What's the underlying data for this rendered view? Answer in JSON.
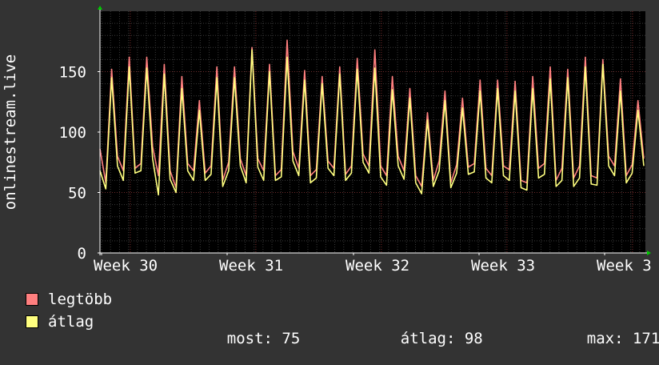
{
  "chart_data": {
    "type": "line",
    "ylabel": "onlinestream.live",
    "ylim": [
      0,
      200
    ],
    "yticks": [
      0,
      50,
      100,
      150
    ],
    "xticks": [
      "Week 30",
      "Week 31",
      "Week 32",
      "Week 33",
      "Week 3"
    ],
    "grid": true,
    "legend_placement": "bottom-left",
    "series": [
      {
        "name": "legtöbb",
        "color": "#ff7f7f",
        "values": [
          86,
          58,
          152,
          80,
          68,
          162,
          70,
          74,
          162,
          88,
          64,
          156,
          68,
          54,
          146,
          74,
          68,
          126,
          66,
          72,
          154,
          60,
          75,
          154,
          78,
          64,
          170,
          78,
          68,
          156,
          64,
          69,
          176,
          84,
          70,
          151,
          64,
          69,
          146,
          76,
          70,
          154,
          65,
          72,
          161,
          82,
          72,
          168,
          72,
          64,
          146,
          80,
          68,
          136,
          64,
          55,
          116,
          60,
          76,
          134,
          58,
          73,
          128,
          71,
          74,
          143,
          70,
          64,
          143,
          72,
          69,
          142,
          60,
          58,
          146,
          70,
          74,
          154,
          60,
          70,
          152,
          62,
          72,
          162,
          64,
          62,
          160,
          80,
          72,
          144,
          64,
          73,
          126,
          78
        ]
      },
      {
        "name": "átlag",
        "color": "#ffff7f",
        "values": [
          68,
          53,
          145,
          72,
          60,
          154,
          66,
          68,
          153,
          78,
          48,
          148,
          61,
          50,
          136,
          68,
          60,
          118,
          60,
          65,
          145,
          55,
          68,
          145,
          72,
          58,
          168,
          71,
          60,
          150,
          60,
          63,
          162,
          76,
          64,
          143,
          58,
          62,
          140,
          70,
          64,
          148,
          60,
          66,
          152,
          75,
          66,
          153,
          63,
          56,
          135,
          72,
          61,
          128,
          58,
          49,
          110,
          55,
          68,
          126,
          54,
          66,
          120,
          65,
          67,
          134,
          62,
          58,
          136,
          64,
          60,
          134,
          54,
          52,
          136,
          62,
          65,
          144,
          55,
          60,
          145,
          55,
          62,
          154,
          57,
          56,
          156,
          72,
          64,
          134,
          58,
          66,
          118,
          72
        ]
      }
    ],
    "stats": {
      "most": 75,
      "atlag": 98,
      "max": 171
    }
  },
  "legend": {
    "items": [
      {
        "label": "legtöbb",
        "color": "#ff7f7f"
      },
      {
        "label": "átlag",
        "color": "#ffff7f"
      }
    ],
    "stats": {
      "most_label": "most:",
      "most_value": "75",
      "atlag_label": "átlag:",
      "atlag_value": "98",
      "max_label": "max:",
      "max_value": "171"
    }
  }
}
